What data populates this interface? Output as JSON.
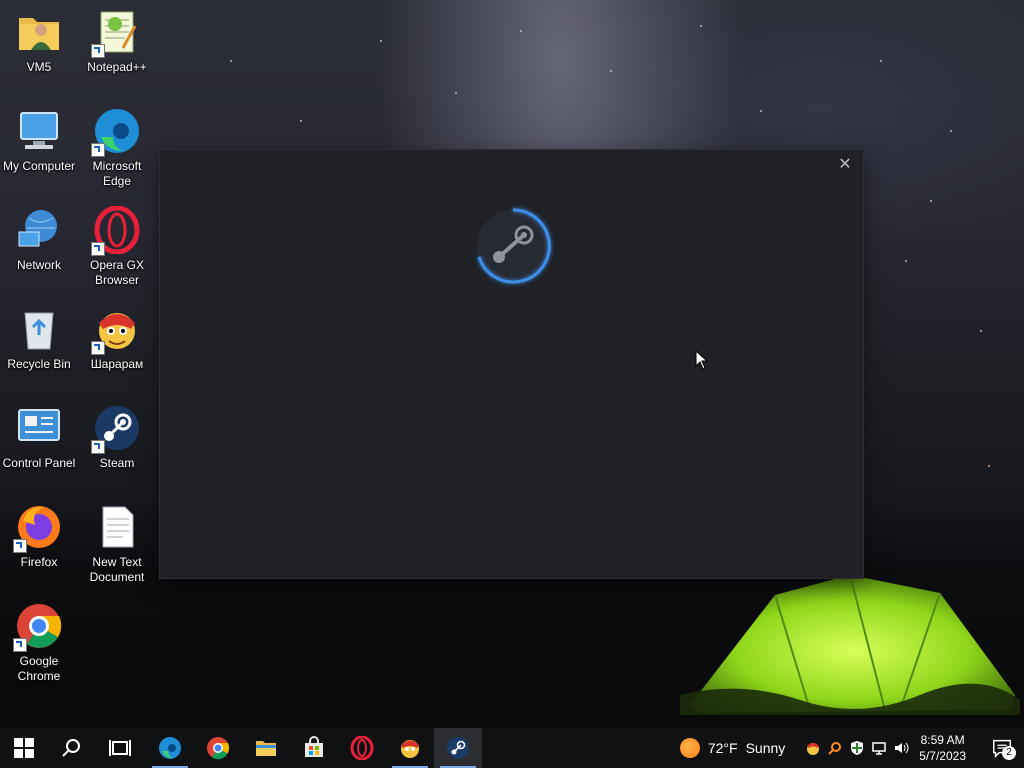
{
  "desktop": {
    "icons": [
      {
        "label": "VM5",
        "icon": "folder-user-icon"
      },
      {
        "label": "Notepad++",
        "icon": "notepadpp-icon"
      },
      {
        "label": "My Computer",
        "icon": "computer-icon"
      },
      {
        "label": "Microsoft Edge",
        "icon": "edge-icon"
      },
      {
        "label": "Network",
        "icon": "network-icon"
      },
      {
        "label": "Opera GX Browser",
        "icon": "opera-gx-icon"
      },
      {
        "label": "Recycle Bin",
        "icon": "recycle-bin-icon"
      },
      {
        "label": "Шарарам",
        "icon": "shararam-icon"
      },
      {
        "label": "Control Panel",
        "icon": "control-panel-icon"
      },
      {
        "label": "Steam",
        "icon": "steam-icon"
      },
      {
        "label": "Firefox",
        "icon": "firefox-icon"
      },
      {
        "label": "New Text Document",
        "icon": "text-document-icon"
      },
      {
        "label": "Google Chrome",
        "icon": "chrome-icon"
      }
    ]
  },
  "steam_window": {
    "close_symbol": "✕",
    "spinner_icon": "steam-loading-spinner-icon"
  },
  "taskbar": {
    "pinned": [
      {
        "name": "start-button",
        "icon": "windows-logo-icon"
      },
      {
        "name": "search-button",
        "icon": "search-icon"
      },
      {
        "name": "task-view-button",
        "icon": "task-view-icon"
      },
      {
        "name": "taskbar-edge",
        "icon": "edge-icon",
        "running": true
      },
      {
        "name": "taskbar-chrome",
        "icon": "chrome-icon"
      },
      {
        "name": "taskbar-file-explorer",
        "icon": "file-explorer-icon"
      },
      {
        "name": "taskbar-microsoft-store",
        "icon": "store-icon"
      },
      {
        "name": "taskbar-opera",
        "icon": "opera-icon"
      },
      {
        "name": "taskbar-shararam",
        "icon": "shararam-icon",
        "running": true
      },
      {
        "name": "taskbar-steam",
        "icon": "steam-icon",
        "active": true
      }
    ],
    "weather": {
      "temp": "72°F",
      "condition": "Sunny"
    },
    "tray_icons": [
      "shararam-tray-icon",
      "search-tray-icon",
      "security-shield-icon",
      "network-icon",
      "volume-icon"
    ],
    "clock": {
      "time": "8:59 AM",
      "date": "5/7/2023"
    },
    "notifications": {
      "count": "2"
    }
  },
  "colors": {
    "steam_window_bg": "#1f2127",
    "taskbar_bg": "#101113",
    "accent_underline": "#7aa7e8",
    "spinner_blue": "#3d8ee8"
  }
}
